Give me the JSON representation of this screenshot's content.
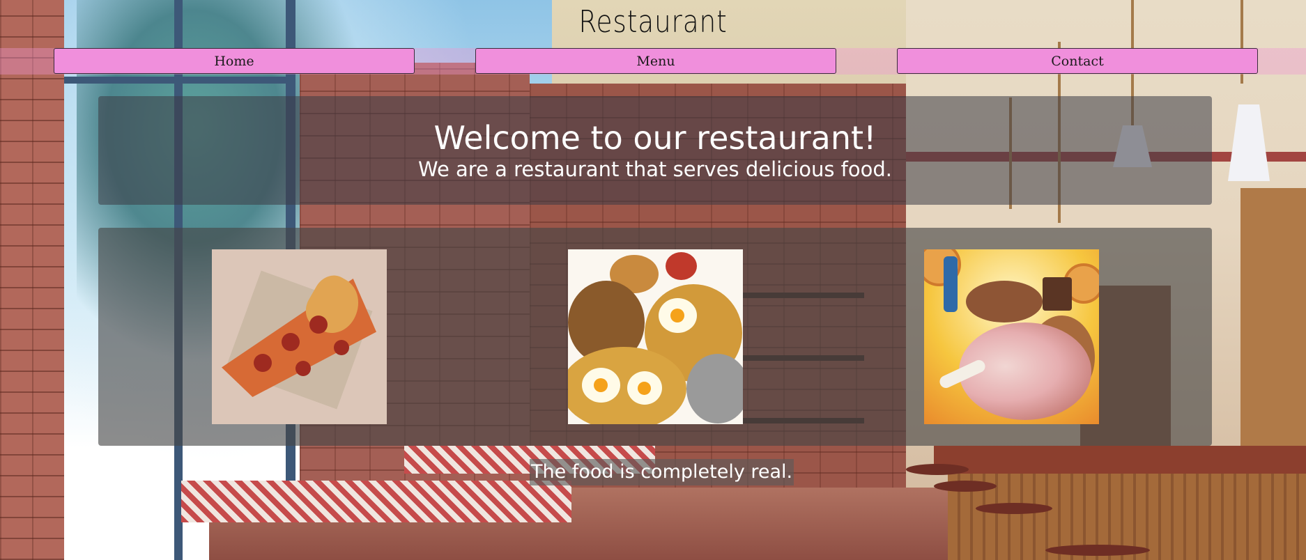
{
  "header": {
    "title": "Restaurant"
  },
  "nav": {
    "items": [
      {
        "label": "Home"
      },
      {
        "label": "Menu"
      },
      {
        "label": "Contact"
      }
    ]
  },
  "welcome": {
    "heading": "Welcome to our restaurant!",
    "subheading": "We are a restaurant that serves delicious food."
  },
  "gallery": {
    "images": [
      {
        "name": "pizza-slice-image"
      },
      {
        "name": "mixed-dishes-image"
      },
      {
        "name": "feast-image"
      }
    ]
  },
  "caption": "The food is completely real.",
  "colors": {
    "nav_bar": "#f08fdc",
    "panel": "#464646",
    "text_light": "#ffffff"
  }
}
